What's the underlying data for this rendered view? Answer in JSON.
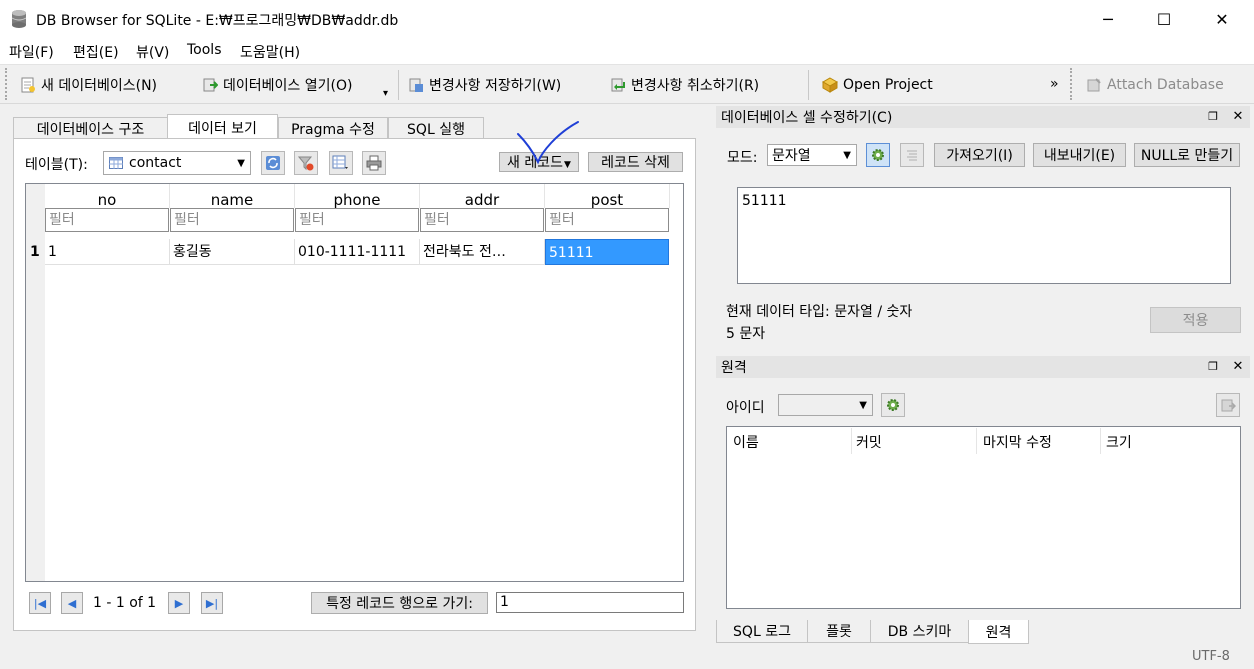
{
  "window": {
    "title": "DB Browser for SQLite - E:₩프로그래밍₩DB₩addr.db",
    "minimize": "─",
    "maximize": "☐",
    "close": "✕"
  },
  "menu": [
    "파일(F)",
    "편집(E)",
    "뷰(V)",
    "Tools",
    "도움말(H)"
  ],
  "toolbar": {
    "new_db": "새 데이터베이스(N)",
    "open_db": "데이터베이스 열기(O)",
    "write_changes": "변경사항 저장하기(W)",
    "revert_changes": "변경사항 취소하기(R)",
    "open_project": "Open Project",
    "overflow": "»",
    "attach_db": "Attach Database",
    "dropdown_arrow": "▾"
  },
  "tabs": [
    "데이터베이스 구조",
    "데이터 보기",
    "Pragma 수정",
    "SQL 실행"
  ],
  "browse": {
    "table_label": "테이블(T):",
    "table_value": "contact",
    "new_record": "새 레코드",
    "delete_record": "레코드 삭제",
    "columns": [
      "no",
      "name",
      "phone",
      "addr",
      "post"
    ],
    "filter_placeholder": "필터",
    "rows": [
      {
        "rownum": "1",
        "cells": [
          "1",
          "홍길동",
          "010-1111-1111",
          "전라북도 전…",
          "51111"
        ]
      }
    ],
    "pagination": "1 - 1 of 1",
    "goto_label": "특정 레코드 행으로 가기:",
    "goto_value": "1"
  },
  "edit_cell": {
    "title": "데이터베이스 셀 수정하기(C)",
    "mode_label": "모드:",
    "mode_value": "문자열",
    "import_btn": "가져오기(I)",
    "export_btn": "내보내기(E)",
    "null_btn": "NULL로 만들기",
    "cell_value": "51111",
    "type_info": "현재 데이터 타입: 문자열 / 숫자",
    "size_info": "5 문자",
    "apply_btn": "적용"
  },
  "remote": {
    "title": "원격",
    "id_label": "아이디",
    "columns": [
      "이름",
      "커밋",
      "마지막 수정",
      "크기"
    ]
  },
  "bottom_tabs": [
    "SQL 로그",
    "플롯",
    "DB 스키마",
    "원격"
  ],
  "status": {
    "encoding": "UTF-8"
  },
  "colors": {
    "selection": "#3399ff",
    "annotation_ink": "#1f3fd6"
  }
}
